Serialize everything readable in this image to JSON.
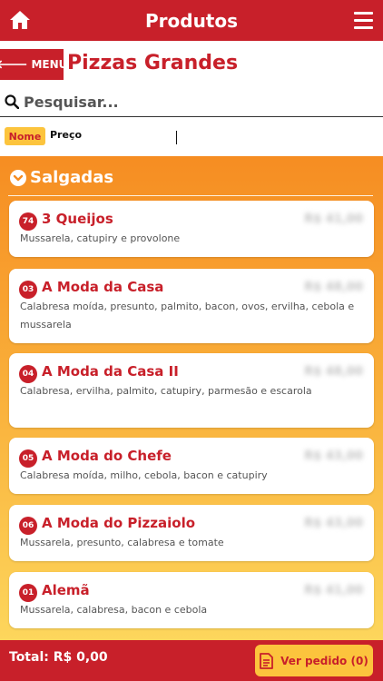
{
  "header": {
    "title": "Produtos",
    "home_icon": "home-icon",
    "menu_icon": "hamburger-menu-icon"
  },
  "subheader": {
    "back_label": "MENU",
    "category_title": "Pizzas Grandes"
  },
  "search": {
    "placeholder": "Pesquisar..."
  },
  "sort": {
    "nome_label": "Nome",
    "preco_label": "Preço"
  },
  "section": {
    "label": "Salgadas"
  },
  "products": [
    {
      "badge": "74",
      "name": "3 Queijos",
      "price": "R$ 41,00",
      "desc": "Mussarela, catupiry e provolone"
    },
    {
      "badge": "03",
      "name": "A Moda da Casa",
      "price": "R$ 48,00",
      "desc": "Calabresa moída, presunto, palmito, bacon, ovos, ervilha, cebola e mussarela"
    },
    {
      "badge": "04",
      "name": "A Moda da Casa II",
      "price": "R$ 48,00",
      "desc": "Calabresa, ervilha, palmito, catupiry, parmesão e escarola"
    },
    {
      "badge": "05",
      "name": "A Moda do Chefe",
      "price": "R$ 43,00",
      "desc": "Calabresa moída, milho, cebola, bacon e catupiry"
    },
    {
      "badge": "06",
      "name": "A Moda do Pizzaiolo",
      "price": "R$ 43,00",
      "desc": "Mussarela, presunto, calabresa e tomate"
    },
    {
      "badge": "01",
      "name": "Alemã",
      "price": "R$ 41,00",
      "desc": "Mussarela, calabresa, bacon e cebola"
    }
  ],
  "footer": {
    "total": "Total: R$ 0,00",
    "order_label": "Ver pedido (0)"
  },
  "colors": {
    "brand_red": "#c8202a",
    "accent_yellow": "#fcc43d",
    "orange_top": "#f68d22",
    "yellow_bottom": "#fdd65c"
  }
}
